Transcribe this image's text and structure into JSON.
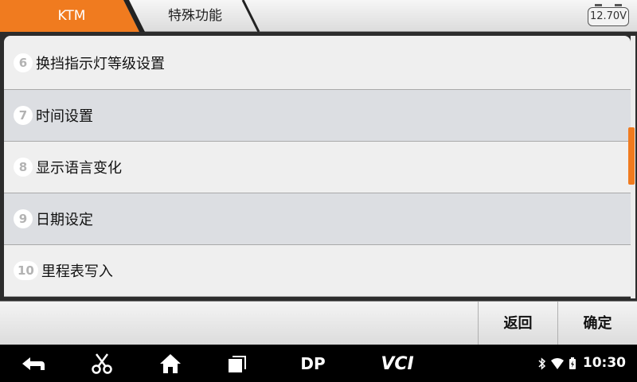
{
  "header": {
    "brand": "KTM",
    "section": "特殊功能",
    "voltage": "12.70V",
    "accent_color": "#f07b1f"
  },
  "list": {
    "items": [
      {
        "number": "6",
        "label": "换挡指示灯等级设置"
      },
      {
        "number": "7",
        "label": "时间设置"
      },
      {
        "number": "8",
        "label": "显示语言变化"
      },
      {
        "number": "9",
        "label": "日期设定"
      },
      {
        "number": "10",
        "label": "里程表写入"
      }
    ]
  },
  "footer": {
    "back_label": "返回",
    "ok_label": "确定"
  },
  "navbar": {
    "icons": [
      "back-icon",
      "scissors-icon",
      "home-icon",
      "recent-apps-icon",
      "dp-icon",
      "vci-icon"
    ],
    "dp_text": "DP",
    "vci_text": "VCI",
    "time": "10:30"
  }
}
